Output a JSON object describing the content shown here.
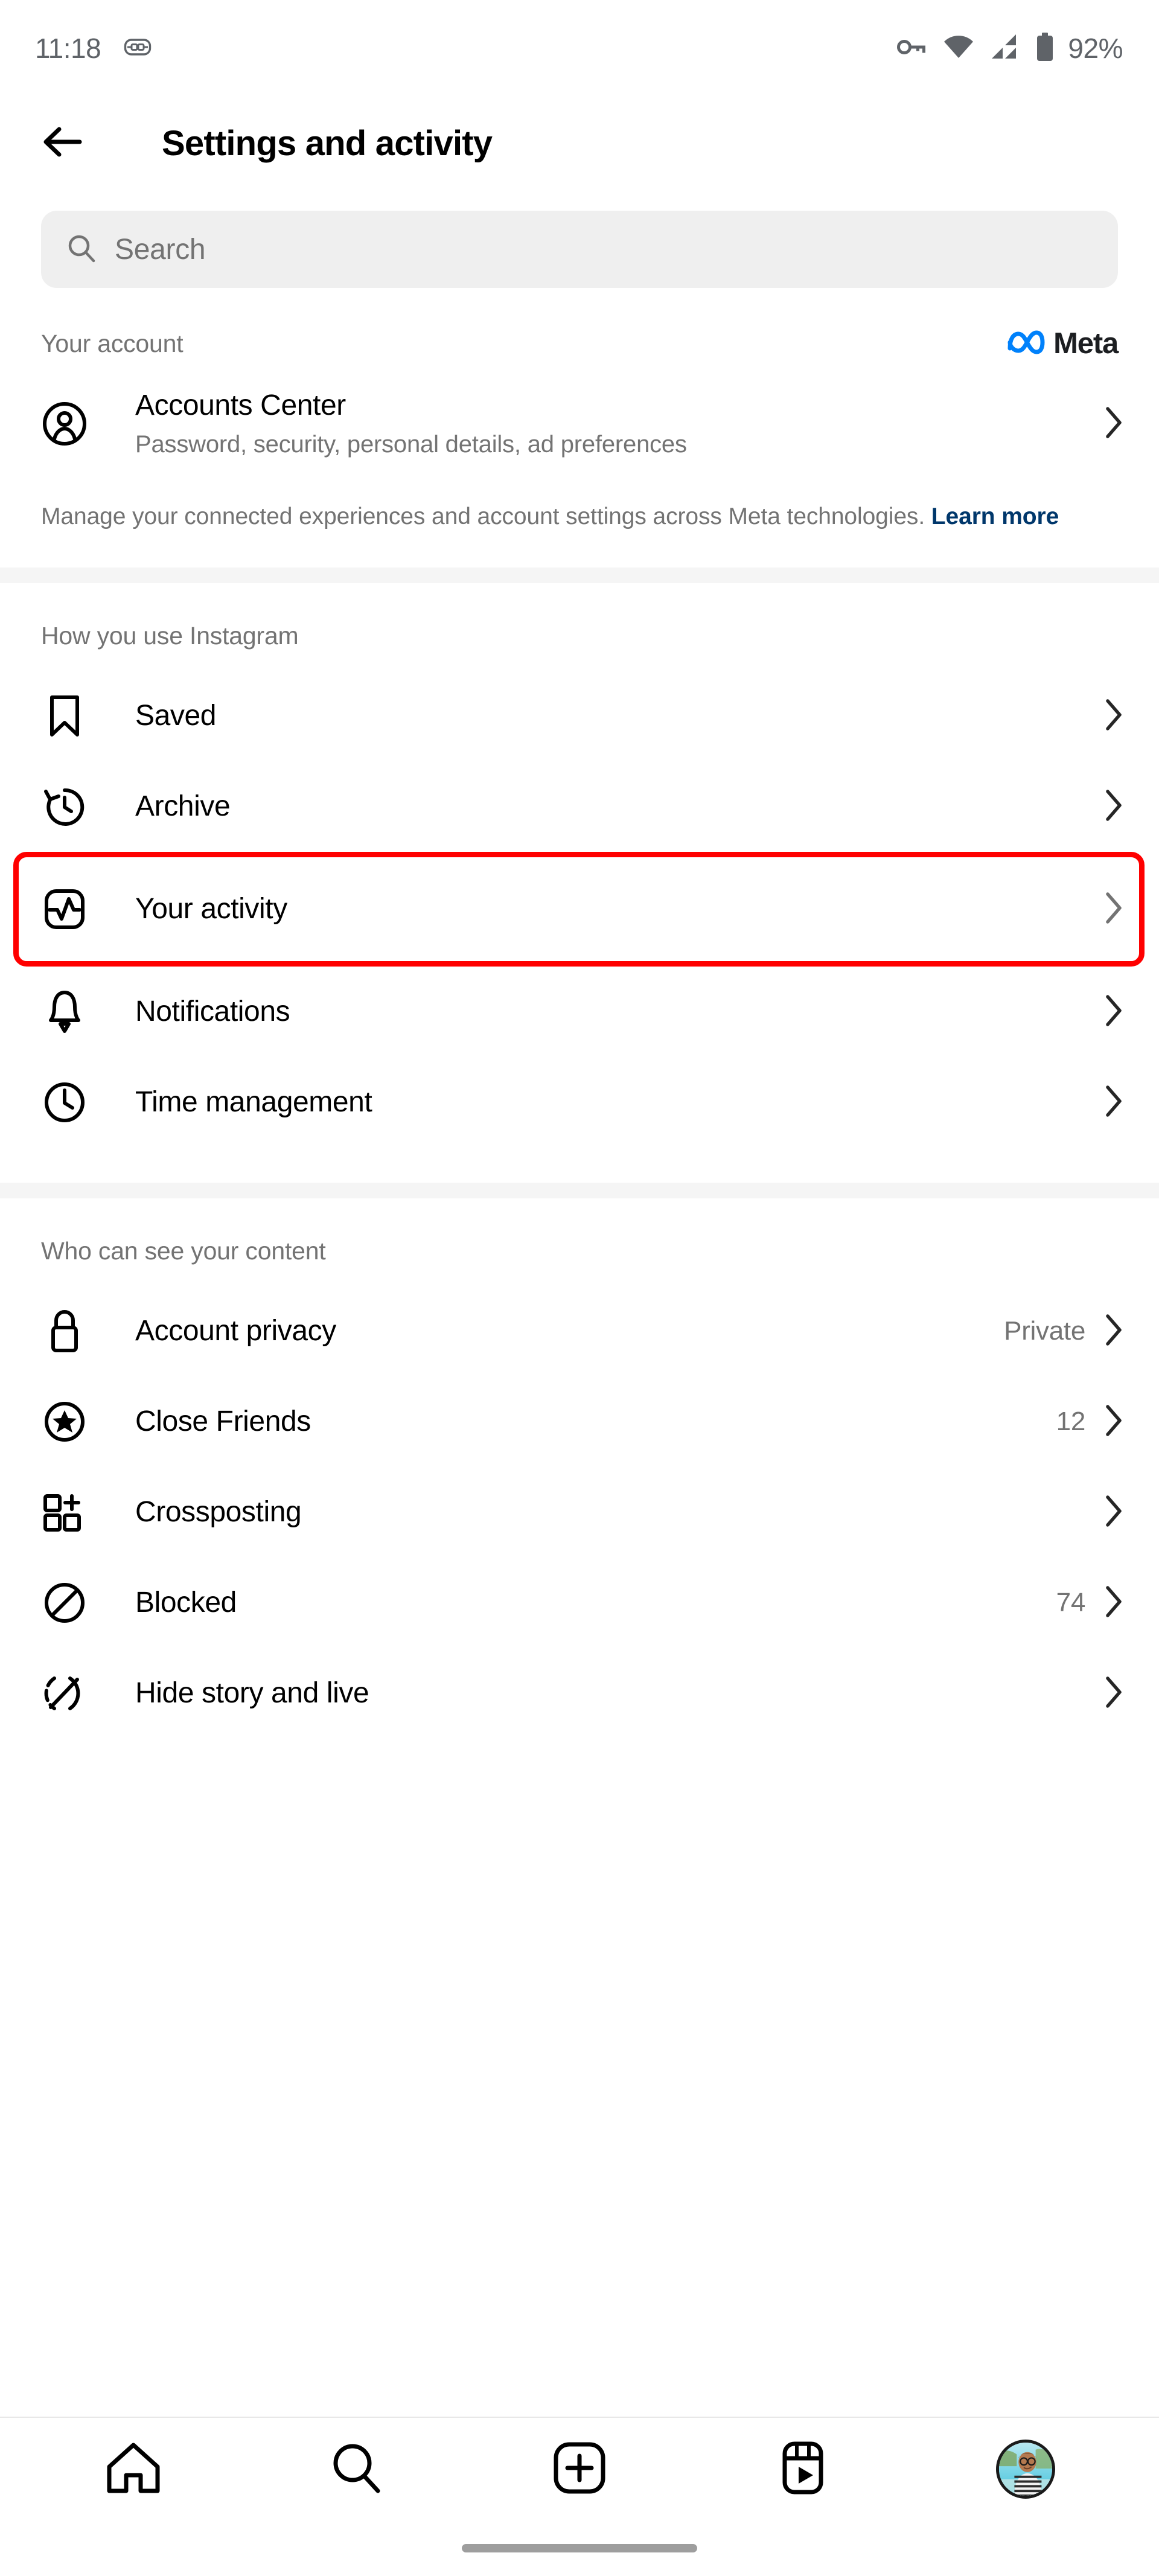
{
  "status_bar": {
    "time": "11:18",
    "battery_percent": "92%",
    "icons": [
      "gamepad-icon",
      "vpn-key-icon",
      "wifi-icon",
      "cell-signal-icon",
      "battery-icon"
    ]
  },
  "header": {
    "title": "Settings and activity",
    "back_icon": "back-arrow-icon"
  },
  "search": {
    "placeholder": "Search",
    "value": "",
    "icon": "search-icon"
  },
  "sections": [
    {
      "label": "Your account",
      "brand": {
        "name": "Meta",
        "logo_color": "#0081FB",
        "text_color": "#1c1e21"
      },
      "rows": [
        {
          "icon": "account-circle-icon",
          "title": "Accounts Center",
          "subtitle": "Password, security, personal details, ad preferences",
          "value": "",
          "chevron": "chevron-right-icon"
        }
      ],
      "helper": {
        "text": "Manage your connected experiences and account settings across Meta technologies. ",
        "link": "Learn more",
        "link_color": "#00376b"
      }
    },
    {
      "label": "How you use Instagram",
      "rows": [
        {
          "icon": "bookmark-icon",
          "title": "Saved",
          "value": "",
          "chevron": "chevron-right-icon",
          "highlighted": false
        },
        {
          "icon": "archive-clock-icon",
          "title": "Archive",
          "value": "",
          "chevron": "chevron-right-icon",
          "highlighted": false
        },
        {
          "icon": "activity-pulse-icon",
          "title": "Your activity",
          "value": "",
          "chevron": "chevron-right-icon",
          "highlighted": true
        },
        {
          "icon": "bell-icon",
          "title": "Notifications",
          "value": "",
          "chevron": "chevron-right-icon",
          "highlighted": false
        },
        {
          "icon": "clock-icon",
          "title": "Time management",
          "value": "",
          "chevron": "chevron-right-icon",
          "highlighted": false
        }
      ]
    },
    {
      "label": "Who can see your content",
      "rows": [
        {
          "icon": "lock-icon",
          "title": "Account privacy",
          "value": "Private",
          "chevron": "chevron-right-icon"
        },
        {
          "icon": "star-circle-icon",
          "title": "Close Friends",
          "value": "12",
          "chevron": "chevron-right-icon"
        },
        {
          "icon": "crossposting-icon",
          "title": "Crossposting",
          "value": "",
          "chevron": "chevron-right-icon"
        },
        {
          "icon": "blocked-icon",
          "title": "Blocked",
          "value": "74",
          "chevron": "chevron-right-icon"
        },
        {
          "icon": "hide-story-icon",
          "title": "Hide story and live",
          "value": "",
          "chevron": "chevron-right-icon"
        }
      ]
    }
  ],
  "highlight": {
    "color": "#ff0000",
    "target": "Your activity"
  },
  "bottom_nav": {
    "items": [
      {
        "icon": "home-icon",
        "name": "home"
      },
      {
        "icon": "search-icon",
        "name": "search"
      },
      {
        "icon": "create-plus-icon",
        "name": "create"
      },
      {
        "icon": "reels-icon",
        "name": "reels"
      },
      {
        "icon": "profile-avatar",
        "name": "profile"
      }
    ]
  }
}
